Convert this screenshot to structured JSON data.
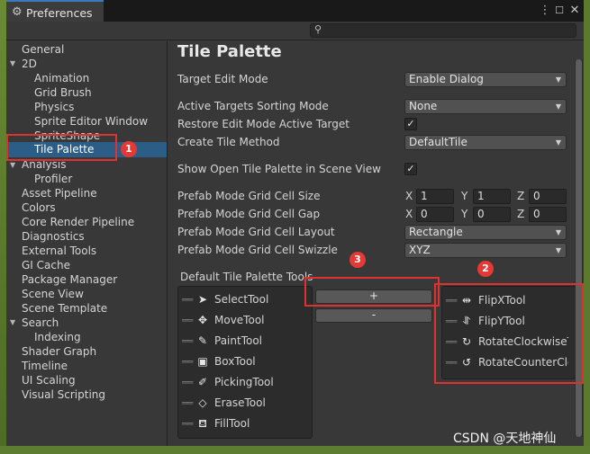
{
  "window": {
    "title": "Preferences",
    "menu_icon": "kebab-menu-icon",
    "maximize_icon": "maximize-icon",
    "close_icon": "close-icon"
  },
  "search": {
    "placeholder": "",
    "icon": "search-icon"
  },
  "sidebar": {
    "items": [
      {
        "label": "General"
      },
      {
        "label": "2D"
      },
      {
        "label": "Animation"
      },
      {
        "label": "Grid Brush"
      },
      {
        "label": "Physics"
      },
      {
        "label": "Sprite Editor Window"
      },
      {
        "label": "SpriteShape"
      },
      {
        "label": "Tile Palette"
      },
      {
        "label": "Analysis"
      },
      {
        "label": "Profiler"
      },
      {
        "label": "Asset Pipeline"
      },
      {
        "label": "Colors"
      },
      {
        "label": "Core Render Pipeline"
      },
      {
        "label": "Diagnostics"
      },
      {
        "label": "External Tools"
      },
      {
        "label": "GI Cache"
      },
      {
        "label": "Package Manager"
      },
      {
        "label": "Scene View"
      },
      {
        "label": "Scene Template"
      },
      {
        "label": "Search"
      },
      {
        "label": "Indexing"
      },
      {
        "label": "Shader Graph"
      },
      {
        "label": "Timeline"
      },
      {
        "label": "UI Scaling"
      },
      {
        "label": "Visual Scripting"
      }
    ],
    "selected": "Tile Palette"
  },
  "content": {
    "title": "Tile Palette",
    "target_edit_mode": {
      "label": "Target Edit Mode",
      "value": "Enable Dialog"
    },
    "active_targets_sorting_mode": {
      "label": "Active Targets Sorting Mode",
      "value": "None"
    },
    "restore_edit_mode": {
      "label": "Restore Edit Mode Active Target",
      "checked": true
    },
    "create_tile_method": {
      "label": "Create Tile Method",
      "value": "DefaultTile"
    },
    "show_open_tile_palette": {
      "label": "Show Open Tile Palette in Scene View",
      "checked": true
    },
    "grid_cell_size": {
      "label": "Prefab Mode Grid Cell Size",
      "x": "1",
      "y": "1",
      "z": "0"
    },
    "grid_cell_gap": {
      "label": "Prefab Mode Grid Cell Gap",
      "x": "0",
      "y": "0",
      "z": "0"
    },
    "grid_cell_layout": {
      "label": "Prefab Mode Grid Cell Layout",
      "value": "Rectangle"
    },
    "grid_cell_swizzle": {
      "label": "Prefab Mode Grid Cell Swizzle",
      "value": "XYZ"
    },
    "axis_labels": {
      "x": "X",
      "y": "Y",
      "z": "Z"
    },
    "tools_header": "Default Tile Palette Tools",
    "tools": [
      {
        "label": "SelectTool",
        "icon": "arrow-pointer-icon"
      },
      {
        "label": "MoveTool",
        "icon": "move-arrows-icon"
      },
      {
        "label": "PaintTool",
        "icon": "paintbrush-icon"
      },
      {
        "label": "BoxTool",
        "icon": "box-fill-icon"
      },
      {
        "label": "PickingTool",
        "icon": "eyedropper-icon"
      },
      {
        "label": "EraseTool",
        "icon": "eraser-icon"
      },
      {
        "label": "FillTool",
        "icon": "paint-bucket-icon"
      }
    ],
    "available_tools": [
      {
        "label": "FlipXTool",
        "icon": "flip-x-icon"
      },
      {
        "label": "FlipYTool",
        "icon": "flip-y-icon"
      },
      {
        "label": "RotateClockwiseTool",
        "icon": "rotate-clockwise-icon"
      },
      {
        "label": "RotateCounterClockwiseTool",
        "icon": "rotate-counterclockwise-icon"
      }
    ],
    "add_button": "+",
    "remove_button": "-"
  },
  "annotations": {
    "badge1": "1",
    "badge2": "2",
    "badge3": "3",
    "color": "#e03131"
  },
  "watermark": "CSDN @天地神仙",
  "colors": {
    "selection": "#2c5d87",
    "accent_tab": "#3a79bb"
  }
}
